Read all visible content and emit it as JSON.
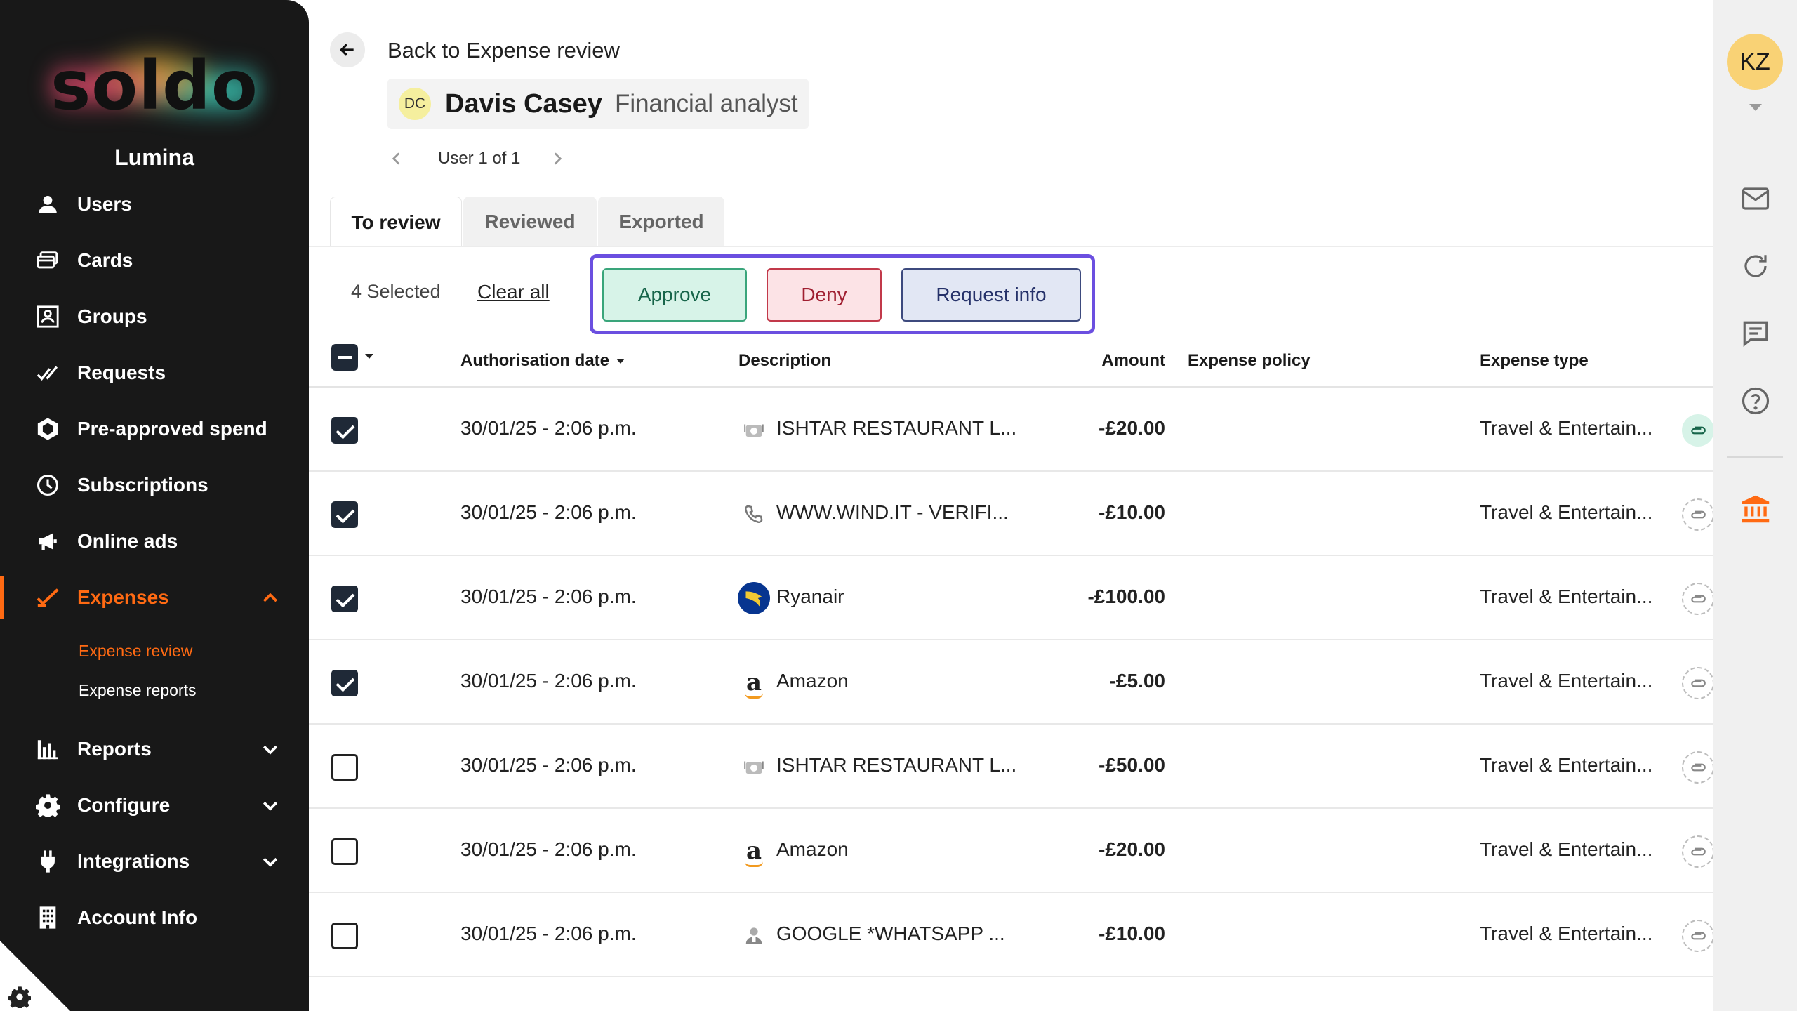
{
  "brand": {
    "logo_text": "soldo",
    "org_name": "Lumina",
    "accent": "#ff6a13"
  },
  "sidebar": {
    "items": [
      {
        "label": "Users",
        "icon": "user-icon"
      },
      {
        "label": "Cards",
        "icon": "cards-icon"
      },
      {
        "label": "Groups",
        "icon": "groups-icon"
      },
      {
        "label": "Requests",
        "icon": "requests-icon"
      },
      {
        "label": "Pre-approved spend",
        "icon": "hexagon-icon"
      },
      {
        "label": "Subscriptions",
        "icon": "clock-icon"
      },
      {
        "label": "Online ads",
        "icon": "megaphone-icon"
      },
      {
        "label": "Expenses",
        "icon": "check-icon",
        "active": true,
        "expanded": true
      },
      {
        "label": "Reports",
        "icon": "bar-chart-icon"
      },
      {
        "label": "Configure",
        "icon": "gear-icon"
      },
      {
        "label": "Integrations",
        "icon": "plug-icon"
      },
      {
        "label": "Account Info",
        "icon": "building-icon"
      }
    ],
    "sub_items": [
      {
        "label": "Expense review",
        "active": true
      },
      {
        "label": "Expense reports"
      }
    ]
  },
  "header": {
    "back_label": "Back to Expense review",
    "user_initials": "DC",
    "user_name": "Davis Casey",
    "user_role": "Financial analyst",
    "pager_label": "User 1 of 1"
  },
  "tabs": [
    {
      "label": "To review",
      "active": true
    },
    {
      "label": "Reviewed"
    },
    {
      "label": "Exported"
    }
  ],
  "toolbar": {
    "selected_label": "4 Selected",
    "clear_all": "Clear all",
    "approve": "Approve",
    "deny": "Deny",
    "request_info": "Request info"
  },
  "table": {
    "columns": {
      "date": "Authorisation date",
      "description": "Description",
      "amount": "Amount",
      "policy": "Expense policy",
      "type": "Expense type"
    },
    "rows": [
      {
        "checked": true,
        "date": "30/01/25 - 2:06 p.m.",
        "icon": "restaurant-icon",
        "description": "ISHTAR RESTAURANT L...",
        "amount": "-£20.00",
        "type": "Travel & Entertain...",
        "attachment": true
      },
      {
        "checked": true,
        "date": "30/01/25 - 2:06 p.m.",
        "icon": "phone-icon",
        "description": "WWW.WIND.IT - VERIFI...",
        "amount": "-£10.00",
        "type": "Travel & Entertain...",
        "attachment": false
      },
      {
        "checked": true,
        "date": "30/01/25 - 2:06 p.m.",
        "icon": "ryanair-icon",
        "description": "Ryanair",
        "amount": "-£100.00",
        "type": "Travel & Entertain...",
        "attachment": false
      },
      {
        "checked": true,
        "date": "30/01/25 - 2:06 p.m.",
        "icon": "amazon-icon",
        "description": "Amazon",
        "amount": "-£5.00",
        "type": "Travel & Entertain...",
        "attachment": false
      },
      {
        "checked": false,
        "date": "30/01/25 - 2:06 p.m.",
        "icon": "restaurant-icon",
        "description": "ISHTAR RESTAURANT L...",
        "amount": "-£50.00",
        "type": "Travel & Entertain...",
        "attachment": false
      },
      {
        "checked": false,
        "date": "30/01/25 - 2:06 p.m.",
        "icon": "amazon-icon",
        "description": "Amazon",
        "amount": "-£20.00",
        "type": "Travel & Entertain...",
        "attachment": false
      },
      {
        "checked": false,
        "date": "30/01/25 - 2:06 p.m.",
        "icon": "person-icon",
        "description": "GOOGLE *WHATSAPP ...",
        "amount": "-£10.00",
        "type": "Travel & Entertain...",
        "attachment": false
      }
    ]
  },
  "rail": {
    "initials": "KZ",
    "icons": [
      "mail-icon",
      "refresh-icon",
      "chat-icon",
      "help-icon",
      "bank-icon"
    ]
  }
}
